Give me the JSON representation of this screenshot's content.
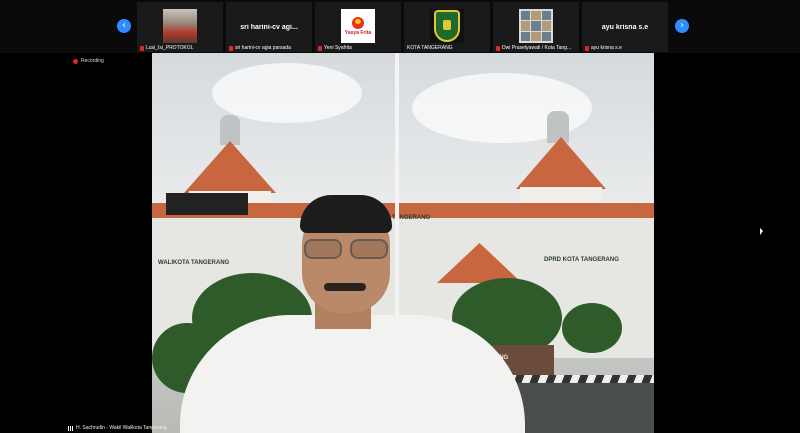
{
  "strip": {
    "nav_prev_glyph": "‹",
    "nav_next_glyph": "›",
    "tiles": [
      {
        "label": "Lusi_Isi_PROTOKOL",
        "kind": "photo",
        "icon": "group-photo"
      },
      {
        "label": "sri harini-cv agia parsada",
        "display_name": "sri harini-cv agi...",
        "kind": "name"
      },
      {
        "label": "Yeni Syafrita",
        "kind": "logo",
        "icon": "yasya-frita-logo",
        "logo_text": "Yasya Frita"
      },
      {
        "label": "KOTA TANGERANG",
        "kind": "crest",
        "icon": "city-crest"
      },
      {
        "label": "Dwi Prasetyawati / Kota Tang...",
        "kind": "photo",
        "icon": "photo-collage"
      },
      {
        "label": "ayu krisna s.e",
        "display_name": "ayu krisna s.e",
        "kind": "name"
      }
    ]
  },
  "status": {
    "recording_label": "Recording"
  },
  "main_video": {
    "speaker_label": "H. Sachrudin - Wakil Walikota Tangerang",
    "scene_text": {
      "walikota": "WALIKOTA TANGERANG",
      "dprd": "DPRD KOTA TANGERANG",
      "gate": "TANGERANG",
      "roof": "TANGERANG"
    }
  },
  "colors": {
    "accent": "#2d8cff",
    "muted_red": "#e02828",
    "roof": "#c8663f"
  }
}
